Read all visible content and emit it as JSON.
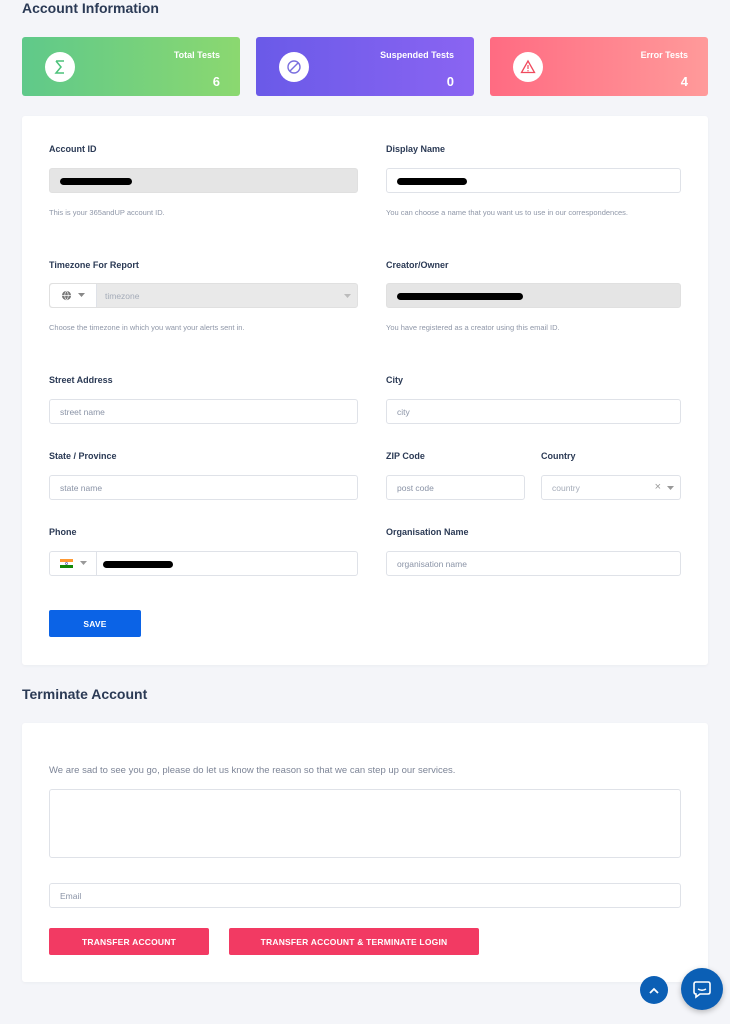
{
  "colors": {
    "stat_green": "#5fc98a",
    "stat_purple": "#7a5cf0",
    "stat_red": "#ff7a8a",
    "primary_blue": "#0b63e6",
    "danger_pink": "#f23a63",
    "fab_blue": "#0b5fb5"
  },
  "account_section": {
    "title": "Account Information"
  },
  "stats": [
    {
      "label": "Total Tests",
      "value": "6",
      "icon": "sigma-icon"
    },
    {
      "label": "Suspended Tests",
      "value": "0",
      "icon": "prohibited-icon"
    },
    {
      "label": "Error Tests",
      "value": "4",
      "icon": "warning-triangle-icon"
    }
  ],
  "form": {
    "account_id": {
      "label": "Account ID",
      "help": "This is your 365andUP account ID."
    },
    "display_name": {
      "label": "Display Name",
      "help": "You can choose a name that you want us to use in our correspondences."
    },
    "timezone": {
      "label": "Timezone For Report",
      "placeholder": "timezone",
      "help": "Choose the timezone in which you want your alerts sent in.",
      "icon": "globe-icon"
    },
    "creator": {
      "label": "Creator/Owner",
      "help": "You have registered as a creator using this email ID."
    },
    "street": {
      "label": "Street Address",
      "placeholder": "street name"
    },
    "city": {
      "label": "City",
      "placeholder": "city"
    },
    "state": {
      "label": "State / Province",
      "placeholder": "state name"
    },
    "zip": {
      "label": "ZIP Code",
      "placeholder": "post code"
    },
    "country": {
      "label": "Country",
      "placeholder": "country",
      "clear": "×"
    },
    "phone": {
      "label": "Phone",
      "flag": "india-flag-icon"
    },
    "organisation": {
      "label": "Organisation Name",
      "placeholder": "organisation name"
    },
    "save_label": "SAVE"
  },
  "terminate_section": {
    "title": "Terminate Account",
    "message": "We are sad to see you go, please do let us know the reason so that we can step up our services.",
    "email_placeholder": "Email",
    "transfer_label": "TRANSFER ACCOUNT",
    "transfer_terminate_label": "TRANSFER ACCOUNT & TERMINATE LOGIN"
  },
  "floating": {
    "scroll_top_icon": "chevron-up-icon",
    "chat_icon": "chat-icon"
  }
}
